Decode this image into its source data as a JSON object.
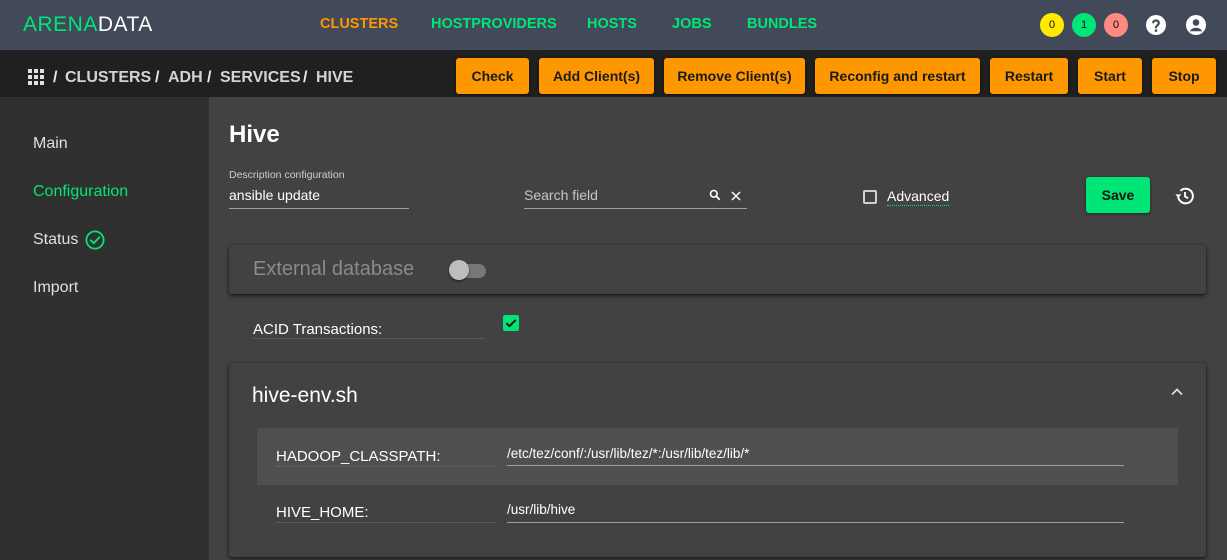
{
  "brand": {
    "part1": "ARENA",
    "part2": "DATA"
  },
  "nav": [
    "CLUSTERS",
    "HOSTPROVIDERS",
    "HOSTS",
    "JOBS",
    "BUNDLES"
  ],
  "badges": [
    "0",
    "1",
    "0"
  ],
  "breadcrumb": [
    "CLUSTERS",
    "ADH",
    "SERVICES",
    "HIVE"
  ],
  "actions": [
    "Check",
    "Add Client(s)",
    "Remove Client(s)",
    "Reconfig and restart",
    "Restart",
    "Start",
    "Stop"
  ],
  "sidebar": [
    "Main",
    "Configuration",
    "Status",
    "Import"
  ],
  "page": {
    "title": "Hive",
    "desc_label": "Description configuration",
    "desc_value": "ansible update",
    "search_placeholder": "Search field",
    "advanced_label": "Advanced",
    "save_label": "Save"
  },
  "config": {
    "external_db_label": "External database",
    "external_db_enabled": false,
    "acid_label": "ACID Transactions:",
    "acid_checked": true,
    "group_title": "hive-env.sh",
    "fields": [
      {
        "label": "HADOOP_CLASSPATH:",
        "value": "/etc/tez/conf/:/usr/lib/tez/*:/usr/lib/tez/lib/*"
      },
      {
        "label": "HIVE_HOME:",
        "value": "/usr/lib/hive"
      }
    ]
  },
  "colors": {
    "accent_green": "#00e676",
    "accent_orange": "#ff9800",
    "badge_yellow": "#ffea00",
    "badge_green": "#00e676",
    "badge_red": "#ff8a80",
    "topbar": "#424a59"
  }
}
